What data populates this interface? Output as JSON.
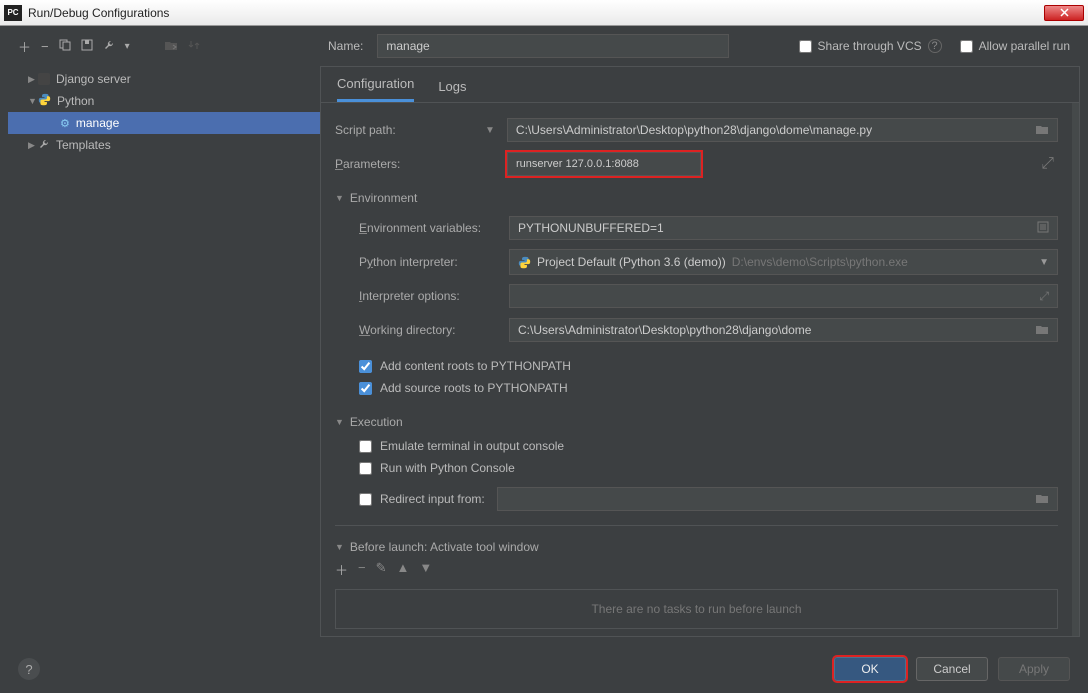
{
  "window": {
    "title": "Run/Debug Configurations"
  },
  "top": {
    "name_label": "Name:",
    "name_value": "manage",
    "share_label": "Share through VCS",
    "parallel_label": "Allow parallel run"
  },
  "tree": {
    "items": [
      {
        "label": "Django server",
        "icon": "django"
      },
      {
        "label": "Python",
        "icon": "python",
        "children": [
          {
            "label": "manage",
            "selected": true
          }
        ]
      },
      {
        "label": "Templates",
        "icon": "wrench"
      }
    ]
  },
  "tabs": {
    "configuration": "Configuration",
    "logs": "Logs"
  },
  "form": {
    "script_path_label": "Script path:",
    "script_path_value": "C:\\Users\\Administrator\\Desktop\\python28\\django\\dome\\manage.py",
    "parameters_label": "Parameters:",
    "parameters_value": "runserver 127.0.0.1:8088",
    "env_section": "Environment",
    "env_vars_label": "Environment variables:",
    "env_vars_value": "PYTHONUNBUFFERED=1",
    "interpreter_label": "Python interpreter:",
    "interpreter_value": "Project Default (Python 3.6 (demo))",
    "interpreter_path": "D:\\envs\\demo\\Scripts\\python.exe",
    "interp_opts_label": "Interpreter options:",
    "interp_opts_value": "",
    "workdir_label": "Working directory:",
    "workdir_value": "C:\\Users\\Administrator\\Desktop\\python28\\django\\dome",
    "add_content_roots": "Add content roots to PYTHONPATH",
    "add_source_roots": "Add source roots to PYTHONPATH",
    "exec_section": "Execution",
    "emulate_terminal": "Emulate terminal in output console",
    "run_with_console": "Run with Python Console",
    "redirect_input": "Redirect input from:",
    "before_launch_section": "Before launch: Activate tool window",
    "no_tasks": "There are no tasks to run before launch"
  },
  "footer": {
    "ok": "OK",
    "cancel": "Cancel",
    "apply": "Apply"
  }
}
